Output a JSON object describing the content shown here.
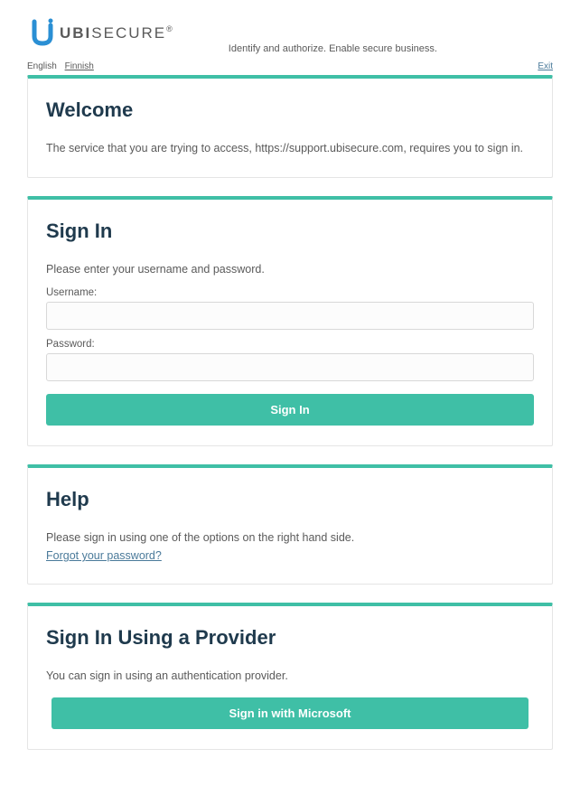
{
  "header": {
    "logo_text_bold": "UBI",
    "logo_text_rest": "SECURE",
    "tagline": "Identify and authorize. Enable secure business."
  },
  "topbar": {
    "langs": [
      "English",
      "Finnish"
    ],
    "exit": "Exit"
  },
  "welcome": {
    "title": "Welcome",
    "body": "The service that you are trying to access, https://support.ubisecure.com, requires you to sign in."
  },
  "signin": {
    "title": "Sign In",
    "instruction": "Please enter your username and password.",
    "username_label": "Username:",
    "password_label": "Password:",
    "button": "Sign In"
  },
  "help": {
    "title": "Help",
    "body": "Please sign in using one of the options on the right hand side.",
    "forgot_link": "Forgot your password?"
  },
  "provider": {
    "title": "Sign In Using a Provider",
    "body": "You can sign in using an authentication provider.",
    "button": "Sign in with Microsoft"
  }
}
